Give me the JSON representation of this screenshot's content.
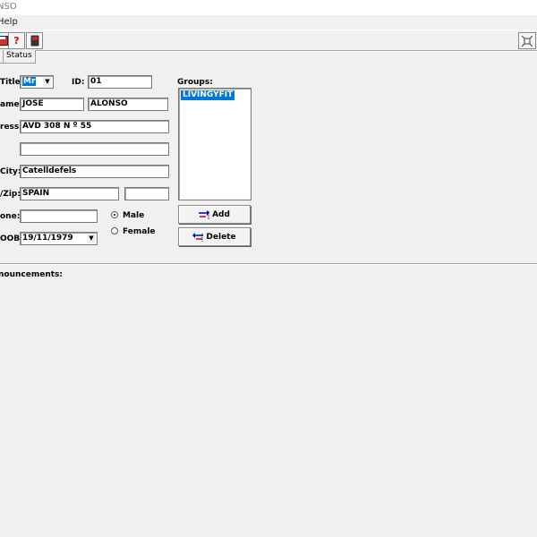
{
  "window": {
    "title": "NSO"
  },
  "menubar": {
    "items": [
      "Help"
    ]
  },
  "toolbar": {
    "buttons": [
      {
        "icon": "save-icon"
      },
      {
        "icon": "help-icon",
        "glyph": "?"
      },
      {
        "icon": "device-icon"
      }
    ],
    "right_button": {
      "icon": "settings-icon"
    }
  },
  "tabs": [
    {
      "label": ""
    },
    {
      "label": "Status"
    }
  ],
  "form": {
    "title_label": "Title:",
    "title_value": "Mr",
    "id_label": "ID:",
    "id_value": "01",
    "name_label": "ame:",
    "first_name": "JOSE",
    "last_name": "ALONSO",
    "address_label": "ress:",
    "address1": "AVD 308 N º 55",
    "address2": "",
    "city_label": "City:",
    "city": "Catelldefels",
    "zip_label": "/Zip:",
    "country": "SPAIN",
    "zip": "",
    "phone_label": "one:",
    "phone": "",
    "dob_label": "OOB:",
    "dob": "19/11/1979",
    "gender_options": [
      "Male",
      "Female"
    ],
    "gender_selected": "Male",
    "groups_label": "Groups:",
    "groups": [
      "LIVINGYFIT"
    ],
    "add_label": "Add",
    "delete_label": "Delete"
  },
  "announcements": {
    "label": "nouncements:"
  },
  "colors": {
    "selection": "#0078d7",
    "background": "#f0f0f0"
  }
}
